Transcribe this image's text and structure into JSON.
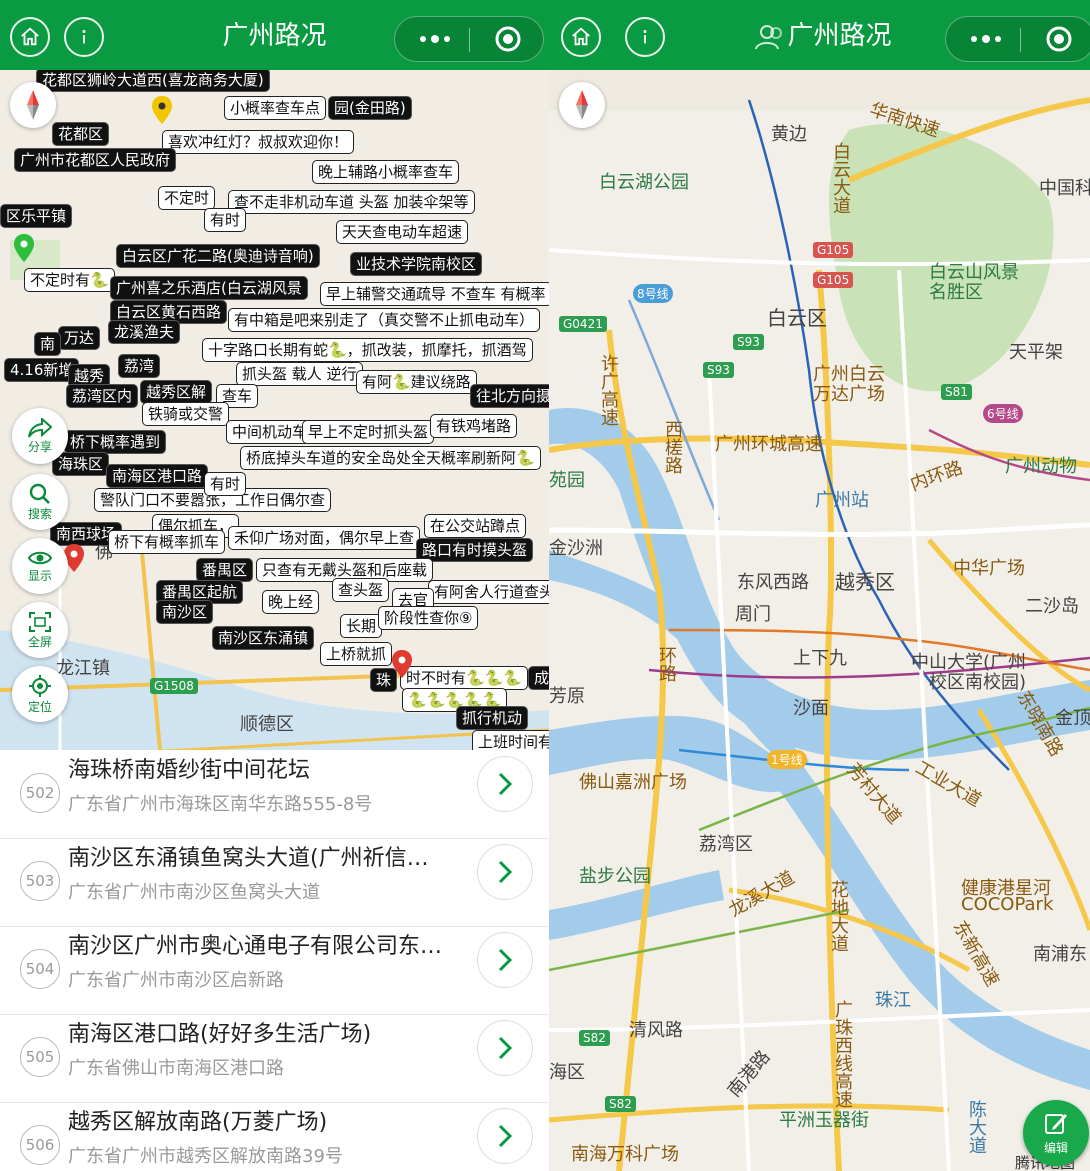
{
  "left": {
    "title": "广州路况",
    "compass": "compass-icon",
    "side_buttons": [
      {
        "label": "分享",
        "icon": "share-icon"
      },
      {
        "label": "搜索",
        "icon": "search-icon"
      },
      {
        "label": "显示",
        "icon": "eye-icon"
      },
      {
        "label": "全屏",
        "icon": "fullscreen-icon"
      },
      {
        "label": "定位",
        "icon": "locate-icon"
      }
    ],
    "map_places": [
      "龙江镇",
      "顺德区",
      "G1508",
      "佛"
    ],
    "labels": [
      "花都区狮岭大道西(喜龙商务大厦)",
      "小概率查车点",
      "园(金田路)",
      "花都区",
      "喜欢冲红灯？叔叔欢迎你！",
      "广州市花都区人民政府",
      "晚上辅路小概率查车",
      "不定时",
      "查不走非机动车道  头盔  加装伞架等",
      "有时",
      "天天查电动车超速",
      "区乐平镇",
      "白云区广花二路(奥迪诗音响)",
      "业技术学院南校区",
      "不定时有🐍",
      "广州喜之乐酒店(白云湖风景",
      "早上辅警交通疏导 不查车 有概率",
      "白云区黄石西路",
      "有中箱是吧来别走了（真交警不止抓电动车）",
      "龙溪渔夫",
      "万达",
      "十字路口长期有蛇🐍，抓改装，抓摩托，抓酒驾",
      "南",
      "荔湾",
      "4.16新增",
      "抓头盔 载人 逆行",
      "有阿🐍建议绕路",
      "越秀",
      "荔湾区内",
      "越秀区解",
      "查车",
      "往北方向摄",
      "铁骑或交警",
      "中间机动车",
      "早上不定时抓头盔",
      "有铁鸡堵路",
      "桥下概率遇到",
      "海珠区",
      "桥底掉头车道的安全岛处全天概率刷新阿🐍",
      "南海区港口路",
      "警队门口不要嚣张，工作日偶尔查",
      "偶尔抓车，",
      "在公交站蹲点",
      "南西球场",
      "桥下有概率抓车",
      "禾仰广场对面，偶尔早上查",
      "路口有时摸头盔",
      "番禺区",
      "只查有无戴头盔和后座载",
      "番禺区起航",
      "查头盔",
      "晚上经",
      "有阿舍人行道查头盔",
      "去官",
      "南沙区",
      "长期",
      "阶段性查你⑨",
      "南沙区东涌镇",
      "上桥就抓",
      "珠",
      "时不时有🐍🐍🐍",
      "成",
      "🐍🐍🐍🐍🐍",
      "抓行机动",
      "上班时间有",
      "有时"
    ]
  },
  "list": [
    {
      "num": "502",
      "title": "海珠桥南婚纱街中间花坛",
      "address": "广东省广州市海珠区南华东路555-8号"
    },
    {
      "num": "503",
      "title": "南沙区东涌镇鱼窝头大道(广州祈信…",
      "address": "广东省广州市南沙区鱼窝头大道"
    },
    {
      "num": "504",
      "title": "南沙区广州市奥心通电子有限公司东…",
      "address": "广东省广州市南沙区启新路"
    },
    {
      "num": "505",
      "title": "南海区港口路(好好多生活广场)",
      "address": "广东省佛山市南海区港口路"
    },
    {
      "num": "506",
      "title": "越秀区解放南路(万菱广场)",
      "address": "广东省广州市越秀区解放南路39号"
    }
  ],
  "right": {
    "title": "广州路况",
    "edit_label": "编辑",
    "watermark": "腾讯地图",
    "places": [
      "黄边",
      "华南快速",
      "白云湖公园",
      "白云大道",
      "中国科",
      "白云山风景",
      "名胜区",
      "G105",
      "G105",
      "8号线",
      "G0421",
      "白云区",
      "S93",
      "S93",
      "广州白云",
      "万达广场",
      "天平架",
      "S81",
      "6号线",
      "许广高速",
      "西槎路",
      "广州环城高速",
      "内环路",
      "广州动物",
      "广州站",
      "苑园",
      "金沙洲",
      "东风西路",
      "越秀区",
      "中华广场",
      "周门",
      "二沙岛",
      "上下九",
      "中山大学(广州",
      "校区南校园)",
      "环路",
      "沙面",
      "金顶",
      "东晓南路",
      "芳原",
      "1号线",
      "佛山嘉洲广场",
      "工业大道",
      "荔湾区",
      "芳村大道",
      "盐步公园",
      "龙溪大道",
      "健康港星河",
      "COCOPark",
      "花地大道",
      "东新高速",
      "南浦东",
      "珠江",
      "S82",
      "清风路",
      "广珠西线高速",
      "海区",
      "南港路",
      "S82",
      "平洲玉器街",
      "南海万科广场",
      "陈大道"
    ]
  },
  "colors": {
    "brand_green": "#0a9a41",
    "map_bg": "#f2efe9",
    "water": "#a3ccea"
  }
}
